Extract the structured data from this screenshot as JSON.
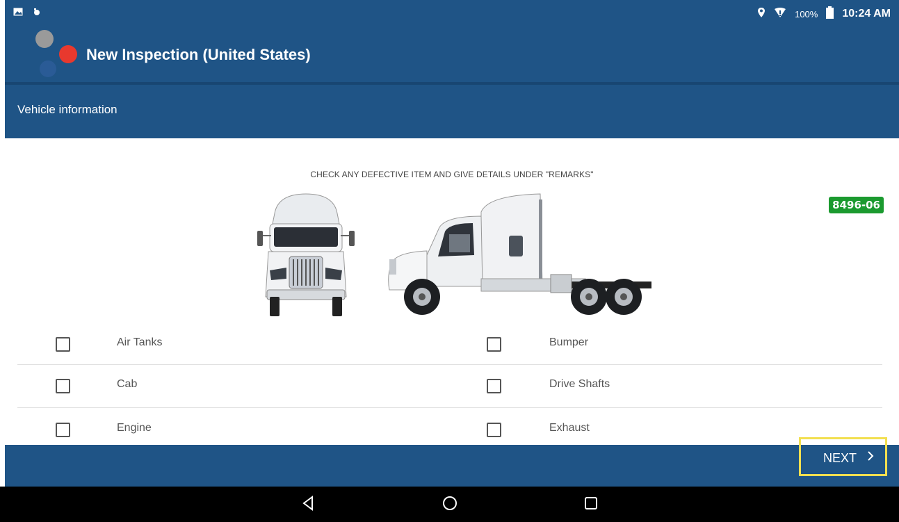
{
  "status_bar": {
    "left_icons": [
      "image-icon",
      "notification-icon"
    ],
    "right_icons": [
      "location-icon",
      "signal-icon",
      "battery-icon"
    ],
    "battery": "100%",
    "time": "10:24 AM"
  },
  "app_bar": {
    "title": "New Inspection (United States)"
  },
  "section": {
    "title": "Vehicle information"
  },
  "inspection": {
    "instruction": "CHECK ANY DEFECTIVE ITEM AND GIVE DETAILS UNDER \"REMARKS\"",
    "unit_badge": "8496-06",
    "items": [
      {
        "left": "Air Tanks",
        "right": "Bumper"
      },
      {
        "left": "Cab",
        "right": "Drive Shafts"
      },
      {
        "left": "Engine",
        "right": "Exhaust"
      }
    ]
  },
  "footer": {
    "next_label": "NEXT",
    "next_icon": "chevron-right-icon"
  },
  "system_nav": [
    "back-icon",
    "home-icon",
    "recents-icon"
  ],
  "colors": {
    "primary": "#1f5486",
    "badge": "#1b9a2f",
    "highlight": "#f2df50"
  }
}
